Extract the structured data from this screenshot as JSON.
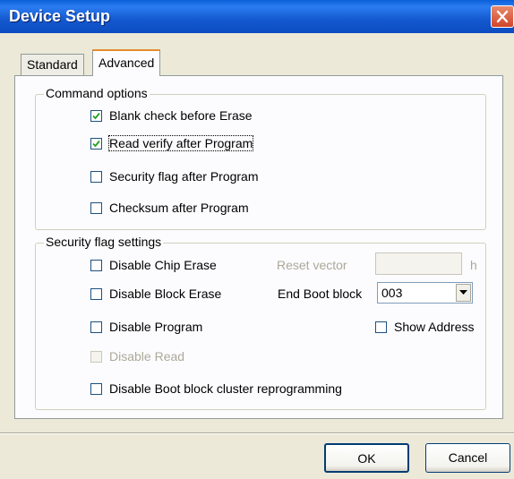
{
  "window": {
    "title": "Device Setup"
  },
  "tabs": [
    {
      "label": "Standard",
      "active": false
    },
    {
      "label": "Advanced",
      "active": true
    }
  ],
  "command_options": {
    "legend": "Command options",
    "items": [
      {
        "label": "Blank check before Erase",
        "checked": true
      },
      {
        "label": "Read verify after Program",
        "checked": true
      },
      {
        "label": "Security flag after Program",
        "checked": false
      },
      {
        "label": "Checksum after Program",
        "checked": false
      }
    ]
  },
  "security_flag_settings": {
    "legend": "Security flag settings",
    "items": [
      {
        "label": "Disable Chip Erase",
        "checked": false,
        "enabled": true
      },
      {
        "label": "Disable Block Erase",
        "checked": false,
        "enabled": true
      },
      {
        "label": "Disable Program",
        "checked": false,
        "enabled": true
      },
      {
        "label": "Disable Read",
        "checked": false,
        "enabled": false
      },
      {
        "label": "Disable Boot block cluster reprogramming",
        "checked": false,
        "enabled": true
      }
    ],
    "reset_vector": {
      "label": "Reset vector",
      "value": "",
      "suffix": "h",
      "enabled": false
    },
    "end_boot_block": {
      "label": "End Boot block",
      "value": "003"
    },
    "show_address": {
      "label": "Show Address",
      "checked": false
    }
  },
  "buttons": {
    "ok": "OK",
    "cancel": "Cancel"
  },
  "colors": {
    "titlebar": "#0A5FD8",
    "dialog_bg": "#ECE9D8",
    "panel_bg": "#FCFCFE",
    "tab_highlight": "#E68B2C",
    "close_button": "#D2452A"
  }
}
